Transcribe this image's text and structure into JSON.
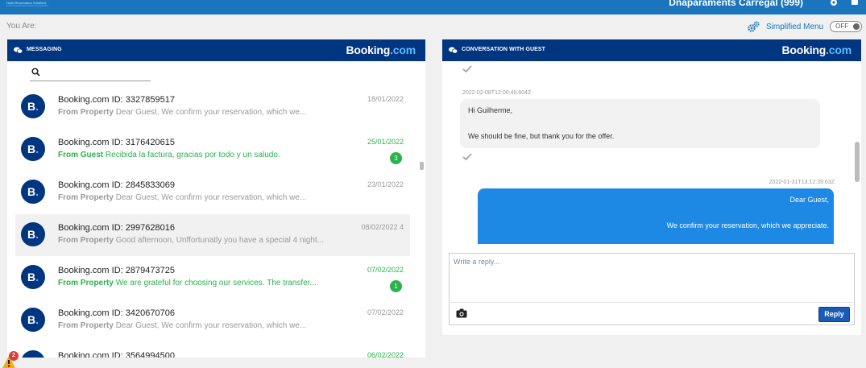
{
  "top_bar": {
    "logo_tagline": "Hotel Reservation Solutions",
    "user_label": "Dnaparaments Carregal (999)"
  },
  "breadcrumb": {
    "label": "You Are:"
  },
  "simplified_menu": {
    "label": "Simplified Menu",
    "toggle_state": "OFF"
  },
  "messaging": {
    "title": "MESSAGING",
    "brand": "Booking",
    "brand_suffix": ".com",
    "search": {
      "placeholder": "",
      "value": ""
    },
    "threads": [
      {
        "title": "Booking.com ID: 3327859517",
        "date": "18/01/2022",
        "from": "From Property",
        "preview": "Dear Guest, We confirm your reservation, which we...",
        "unread": null,
        "highlight": false,
        "green": false
      },
      {
        "title": "Booking.com ID: 3176420615",
        "date": "25/01/2022",
        "from": "From Guest",
        "preview": "Recibida la factura, gracias por todo y un saludo.",
        "unread": "3",
        "highlight": false,
        "green": true
      },
      {
        "title": "Booking.com ID: 2845833069",
        "date": "23/01/2022",
        "from": "From Property",
        "preview": "Dear Guest, We confirm your reservation, which we...",
        "unread": null,
        "highlight": false,
        "green": false
      },
      {
        "title": "Booking.com ID: 2997628016",
        "date": "08/02/2022 4",
        "from": "From Property",
        "preview": "Good afternoon, Unffortunatly you have a special 4 night...",
        "unread": null,
        "highlight": true,
        "green": false
      },
      {
        "title": "Booking.com ID: 2879473725",
        "date": "07/02/2022",
        "from": "From Property",
        "preview": "We are grateful for choosing our services. The transfer...",
        "unread": "1",
        "highlight": false,
        "green": true
      },
      {
        "title": "Booking.com ID: 3420670706",
        "date": "07/02/2022",
        "from": "From Property",
        "preview": "Dear Guest, We confirm your reservation, which we...",
        "unread": null,
        "highlight": false,
        "green": false
      },
      {
        "title": "Booking.com ID: 3564994500",
        "date": "06/02/2022",
        "from": "",
        "preview": "",
        "unread": null,
        "highlight": false,
        "green": true
      }
    ]
  },
  "conversation": {
    "title": "CONVERSATION WITH GUEST",
    "brand": "Booking",
    "brand_suffix": ".com",
    "messages": [
      {
        "direction": "incoming",
        "timestamp": "2022-02-08T12:00:49.604Z",
        "line1": "Hi Guilherme,",
        "line2": "We should be fine, but thank you for the offer."
      },
      {
        "direction": "outgoing",
        "timestamp": "2022-01-31T13:12:39.63Z",
        "line1": "Dear Guest,",
        "line2": "We confirm your reservation, which we appreciate."
      }
    ],
    "reply": {
      "placeholder": "Write a reply...",
      "button_label": "Reply"
    }
  },
  "alerts": {
    "count": "2"
  },
  "icons": {
    "messaging": "chat-bubbles-icon",
    "settings": "gear-icon",
    "search": "search-icon",
    "camera": "camera-icon",
    "check": "checkmark-icon",
    "warning": "warning-icon"
  },
  "colors": {
    "top_bar": "#1b75bc",
    "panel_header": "#003580",
    "brand_accent": "#5bbaff",
    "unread_green": "#2bb24c",
    "outgoing_bubble": "#1e88e5",
    "reply_button": "#1a5bb5"
  }
}
